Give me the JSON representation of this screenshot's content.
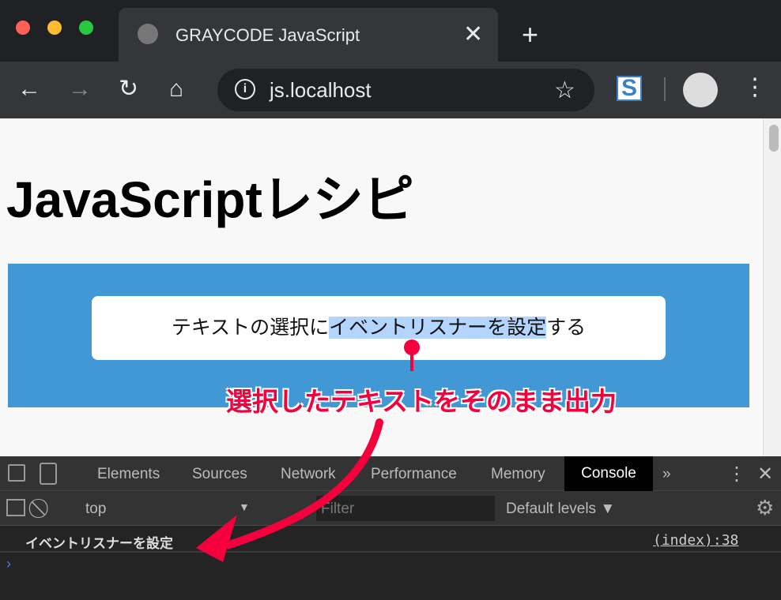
{
  "browser": {
    "tab_title": "GRAYCODE JavaScript",
    "address": "js.localhost",
    "icons": [
      "back-icon",
      "forward-icon",
      "reload-icon",
      "home-icon",
      "info-icon",
      "star-icon",
      "extension-s-icon",
      "profile-avatar-icon",
      "menu-icon"
    ]
  },
  "page": {
    "heading": "JavaScriptレシピ",
    "text_before": "テキストの選択に",
    "text_selected": "イベントリスナーを設定",
    "text_after": "する",
    "colors": {
      "box": "#4298d4",
      "selection": "#b3d4fc"
    }
  },
  "annotation": {
    "text": "選択したテキストをそのまま出力",
    "color": "#f5003d"
  },
  "devtools": {
    "tabs": [
      "Elements",
      "Sources",
      "Network",
      "Performance",
      "Memory",
      "Console"
    ],
    "active_tab": "Console",
    "context": "top",
    "filter_placeholder": "Filter",
    "levels": "Default levels ▼",
    "log": {
      "message": "イベントリスナーを設定",
      "source": "(index):38"
    }
  }
}
